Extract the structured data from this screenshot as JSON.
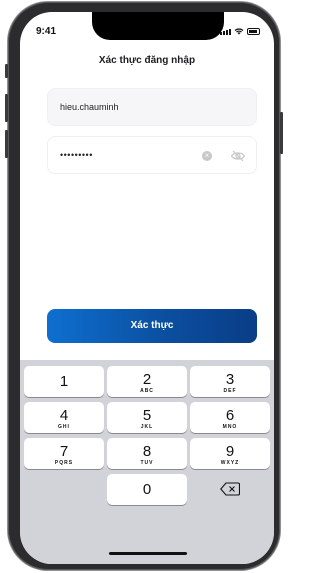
{
  "status_bar": {
    "time": "9:41"
  },
  "title": "Xác thực đăng nhập",
  "username_field": {
    "value": "hieu.chauminh"
  },
  "password_field": {
    "masked_value": "•••••••••"
  },
  "submit_button": {
    "label": "Xác thực"
  },
  "keypad": {
    "keys": [
      {
        "num": "1",
        "letters": ""
      },
      {
        "num": "2",
        "letters": "ABC"
      },
      {
        "num": "3",
        "letters": "DEF"
      },
      {
        "num": "4",
        "letters": "GHI"
      },
      {
        "num": "5",
        "letters": "JKL"
      },
      {
        "num": "6",
        "letters": "MNO"
      },
      {
        "num": "7",
        "letters": "PQRS"
      },
      {
        "num": "8",
        "letters": "TUV"
      },
      {
        "num": "9",
        "letters": "WXYZ"
      },
      {
        "num": "0",
        "letters": ""
      }
    ]
  },
  "colors": {
    "accent_start": "#0e6fd0",
    "accent_end": "#0a3d86",
    "keypad_bg": "#d1d3d9"
  },
  "icons": [
    "signal-icon",
    "wifi-icon",
    "battery-icon",
    "clear-icon",
    "eye-off-icon",
    "backspace-icon"
  ]
}
